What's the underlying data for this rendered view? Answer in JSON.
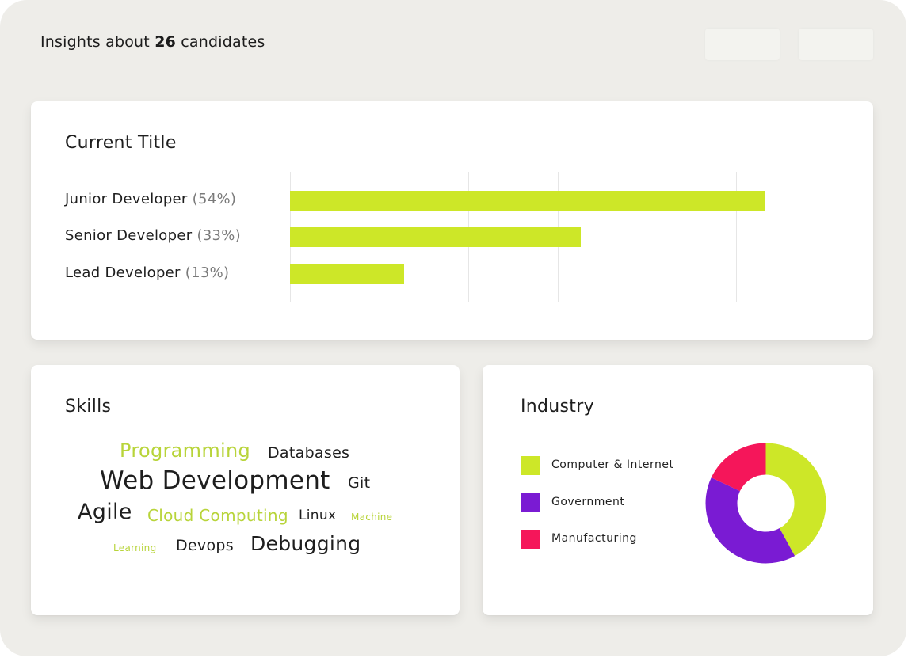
{
  "header": {
    "prefix": "Insights about ",
    "count": "26",
    "suffix": " candidates"
  },
  "current_title": {
    "title": "Current Title",
    "rows": [
      {
        "label": "Junior Developer",
        "pct_label": "(54%)",
        "value": 54
      },
      {
        "label": "Senior Developer",
        "pct_label": "(33%)",
        "value": 33
      },
      {
        "label": "Lead Developer",
        "pct_label": "(13%)",
        "value": 13
      }
    ]
  },
  "skills": {
    "title": "Skills",
    "words": [
      {
        "text": "Programming",
        "color": "#b8d43a"
      },
      {
        "text": "Databases",
        "color": "#1e1e1e"
      },
      {
        "text": "Web Development",
        "color": "#1e1e1e"
      },
      {
        "text": "Git",
        "color": "#1e1e1e"
      },
      {
        "text": "Agile",
        "color": "#1e1e1e"
      },
      {
        "text": "Cloud Computing",
        "color": "#b8d43a"
      },
      {
        "text": "Linux",
        "color": "#1e1e1e"
      },
      {
        "text": "Machine",
        "color": "#b8d43a"
      },
      {
        "text": "Learning",
        "color": "#b8d43a"
      },
      {
        "text": "Devops",
        "color": "#1e1e1e"
      },
      {
        "text": "Debugging",
        "color": "#1e1e1e"
      }
    ]
  },
  "industry": {
    "title": "Industry",
    "legend": [
      {
        "label": "Computer & Internet",
        "color": "#cde728"
      },
      {
        "label": "Government",
        "color": "#7a1bd3"
      },
      {
        "label": "Manufacturing",
        "color": "#f5165a"
      }
    ]
  },
  "chart_data": [
    {
      "type": "bar",
      "title": "Current Title",
      "orientation": "horizontal",
      "categories": [
        "Junior Developer",
        "Senior Developer",
        "Lead Developer"
      ],
      "values": [
        54,
        33,
        13
      ],
      "unit": "%",
      "xlim": [
        0,
        55
      ],
      "grid": true,
      "color": "#cde728"
    },
    {
      "type": "pie",
      "title": "Industry",
      "donut": true,
      "labels": [
        "Computer & Internet",
        "Government",
        "Manufacturing"
      ],
      "values": [
        42,
        40,
        18
      ],
      "colors": [
        "#cde728",
        "#7a1bd3",
        "#f5165a"
      ],
      "legend": "left"
    }
  ]
}
